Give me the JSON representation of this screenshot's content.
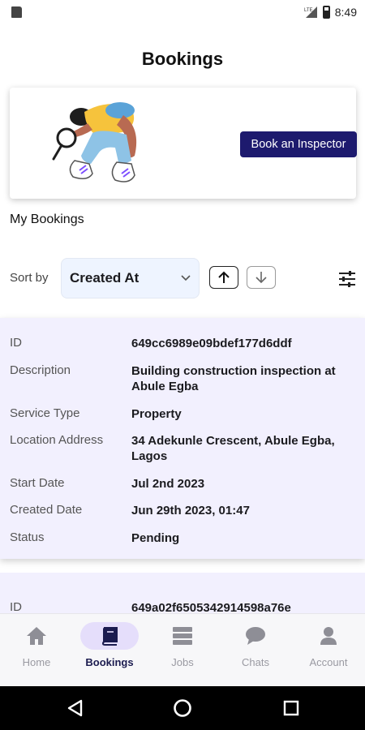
{
  "status_bar": {
    "time": "8:49"
  },
  "page": {
    "title": "Bookings"
  },
  "banner": {
    "button_label": "Book an Inspector"
  },
  "section": {
    "title": "My Bookings"
  },
  "sort": {
    "label": "Sort by",
    "selected": "Created At"
  },
  "labels": {
    "id": "ID",
    "description": "Description",
    "service_type": "Service Type",
    "location_address": "Location Address",
    "start_date": "Start Date",
    "created_date": "Created Date",
    "status": "Status"
  },
  "bookings": [
    {
      "id": "649cc6989e09bdef177d6ddf",
      "description": "Building construction inspection at Abule Egba",
      "service_type": "Property",
      "location_address": "34 Adekunle Crescent, Abule Egba, Lagos",
      "start_date": "Jul 2nd 2023",
      "created_date": "Jun 29th 2023, 01:47",
      "status": "Pending"
    },
    {
      "id": "649a02f6505342914598a76e"
    }
  ],
  "nav": {
    "items": [
      {
        "label": "Home",
        "icon": "home-icon"
      },
      {
        "label": "Bookings",
        "icon": "book-icon"
      },
      {
        "label": "Jobs",
        "icon": "jobs-icon"
      },
      {
        "label": "Chats",
        "icon": "chat-icon"
      },
      {
        "label": "Account",
        "icon": "account-icon"
      }
    ],
    "active": "Bookings"
  },
  "colors": {
    "primary": "#1d1a6e",
    "card_bg": "#f2f0fe",
    "sort_bg": "#eef4ff",
    "nav_active_pill": "#e5defb"
  }
}
